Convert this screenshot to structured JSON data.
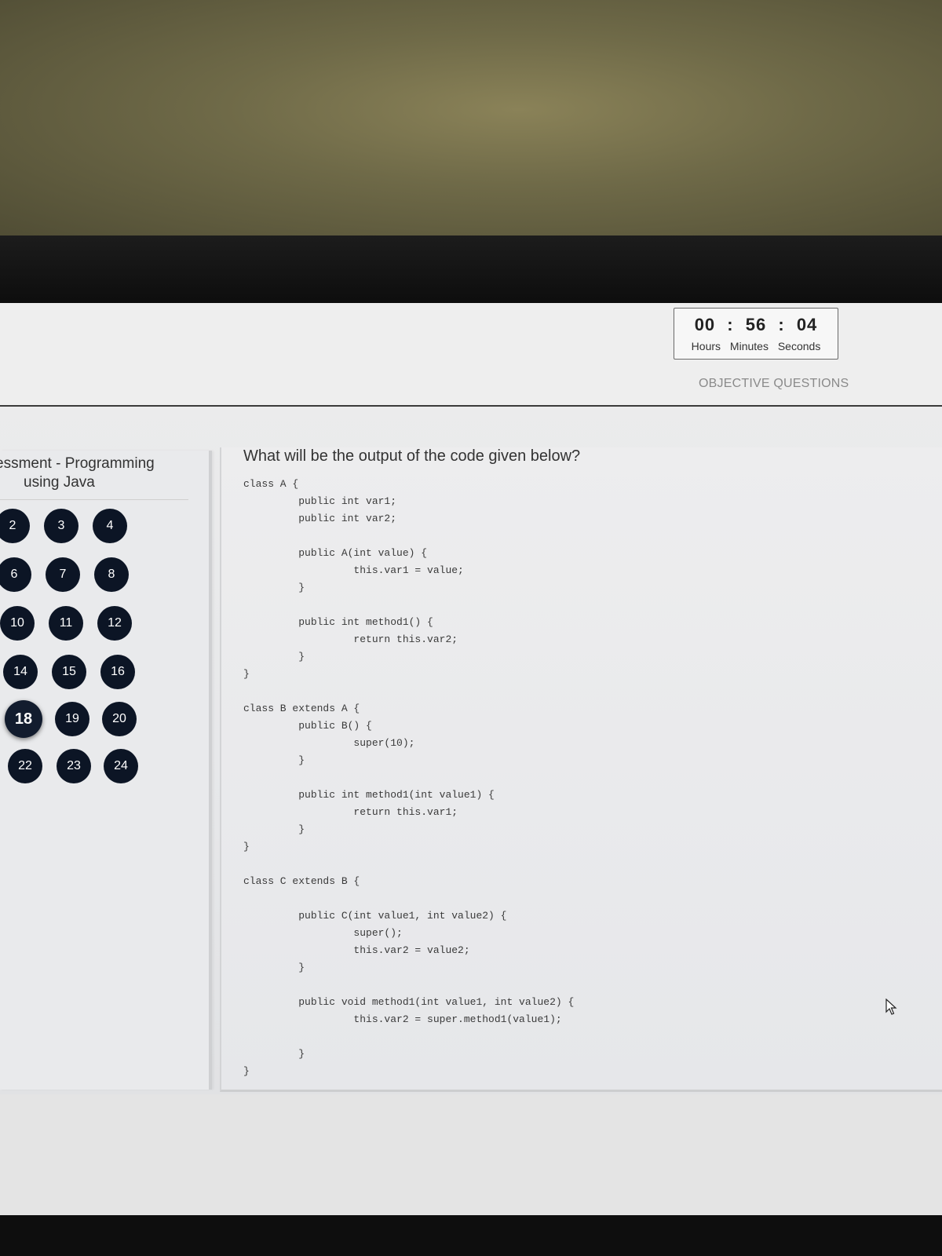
{
  "timer": {
    "hours": "00",
    "minutes": "56",
    "seconds": "04",
    "separator": ":",
    "hours_label": "Hours",
    "minutes_label": "Minutes",
    "seconds_label": "Seconds"
  },
  "section_label": "OBJECTIVE QUESTIONS",
  "sidebar": {
    "course_line1": "essment - Programming",
    "course_line2": "using Java",
    "questions": [
      "2",
      "3",
      "4",
      "6",
      "7",
      "8",
      "10",
      "11",
      "12",
      "14",
      "15",
      "16",
      "18",
      "19",
      "20",
      "22",
      "23",
      "24"
    ],
    "current": "18"
  },
  "question": {
    "text": "What will be the output of the code given below?",
    "code": "class A {\n         public int var1;\n         public int var2;\n\n         public A(int value) {\n                  this.var1 = value;\n         }\n\n         public int method1() {\n                  return this.var2;\n         }\n}\n\nclass B extends A {\n         public B() {\n                  super(10);\n         }\n\n         public int method1(int value1) {\n                  return this.var1;\n         }\n}\n\nclass C extends B {\n\n         public C(int value1, int value2) {\n                  super();\n                  this.var2 = value2;\n         }\n\n         public void method1(int value1, int value2) {\n                  this.var2 = super.method1(value1);\n\n         }\n}"
  },
  "icons": {
    "cursor": "mouse-pointer-icon"
  }
}
